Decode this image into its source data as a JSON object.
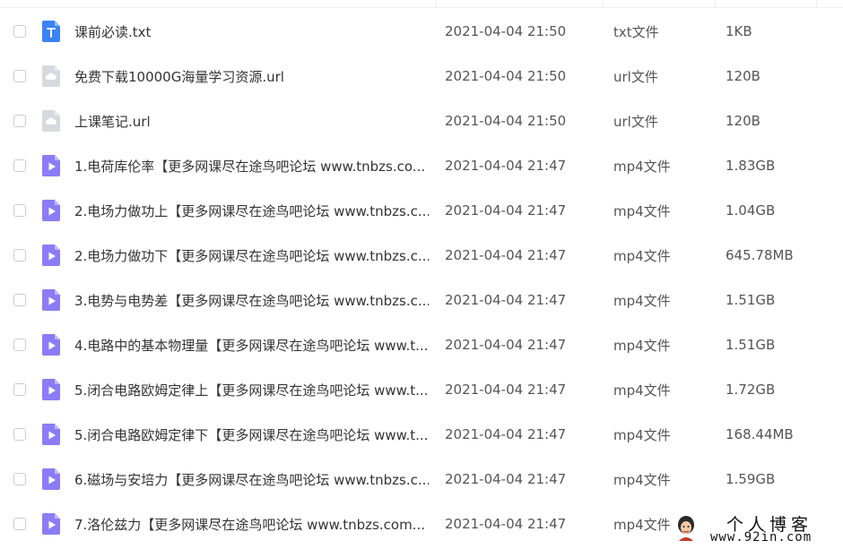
{
  "files": [
    {
      "name": "课前必读.txt",
      "date": "2021-04-04 21:50",
      "type": "txt文件",
      "size": "1KB",
      "icon": "txt-file-icon"
    },
    {
      "name": "免费下载10000G海量学习资源.url",
      "date": "2021-04-04 21:50",
      "type": "url文件",
      "size": "120B",
      "icon": "url-file-icon"
    },
    {
      "name": "上课笔记.url",
      "date": "2021-04-04 21:50",
      "type": "url文件",
      "size": "120B",
      "icon": "url-file-icon"
    },
    {
      "name": "1.电荷库伦率【更多网课尽在途鸟吧论坛 www.tnbzs.co...",
      "date": "2021-04-04 21:47",
      "type": "mp4文件",
      "size": "1.83GB",
      "icon": "video-file-icon"
    },
    {
      "name": "2.电场力做功上【更多网课尽在途鸟吧论坛 www.tnbzs.c...",
      "date": "2021-04-04 21:47",
      "type": "mp4文件",
      "size": "1.04GB",
      "icon": "video-file-icon"
    },
    {
      "name": "2.电场力做功下【更多网课尽在途鸟吧论坛 www.tnbzs.c...",
      "date": "2021-04-04 21:47",
      "type": "mp4文件",
      "size": "645.78MB",
      "icon": "video-file-icon"
    },
    {
      "name": "3.电势与电势差【更多网课尽在途鸟吧论坛 www.tnbzs.c...",
      "date": "2021-04-04 21:47",
      "type": "mp4文件",
      "size": "1.51GB",
      "icon": "video-file-icon"
    },
    {
      "name": "4.电路中的基本物理量【更多网课尽在途鸟吧论坛 www.t...",
      "date": "2021-04-04 21:47",
      "type": "mp4文件",
      "size": "1.51GB",
      "icon": "video-file-icon"
    },
    {
      "name": "5.闭合电路欧姆定律上【更多网课尽在途鸟吧论坛 www.t...",
      "date": "2021-04-04 21:47",
      "type": "mp4文件",
      "size": "1.72GB",
      "icon": "video-file-icon"
    },
    {
      "name": "5.闭合电路欧姆定律下【更多网课尽在途鸟吧论坛 www.t...",
      "date": "2021-04-04 21:47",
      "type": "mp4文件",
      "size": "168.44MB",
      "icon": "video-file-icon"
    },
    {
      "name": "6.磁场与安培力【更多网课尽在途鸟吧论坛 www.tnbzs.c...",
      "date": "2021-04-04 21:47",
      "type": "mp4文件",
      "size": "1.59GB",
      "icon": "video-file-icon"
    },
    {
      "name": "7.洛伦兹力【更多网课尽在途鸟吧论坛 www.tnbzs.com...",
      "date": "2021-04-04 21:47",
      "type": "mp4文件",
      "size": "",
      "icon": "video-file-icon"
    }
  ],
  "watermark": {
    "title": "个人博客",
    "url": "www.92in.com"
  },
  "colors": {
    "txt_icon": "#3b82f6",
    "url_icon": "#d7d9de",
    "video_icon": "#8b7cf6"
  }
}
